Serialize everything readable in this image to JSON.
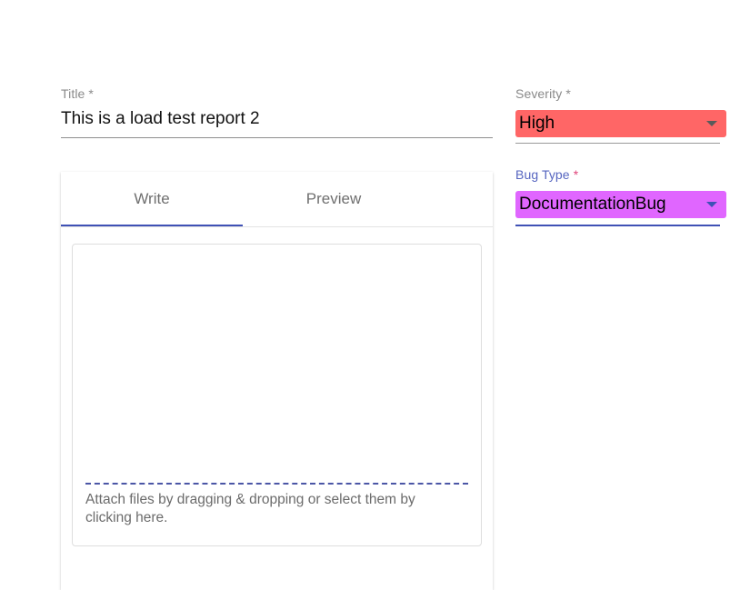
{
  "title_field": {
    "label": "Title *",
    "value": "This is a load test report 2"
  },
  "editor": {
    "tabs": [
      {
        "label": "Write",
        "active": true
      },
      {
        "label": "Preview",
        "active": false
      }
    ],
    "attach_text": "Attach files by dragging & dropping or select them by clicking here."
  },
  "severity": {
    "label": "Severity *",
    "value": "High",
    "color": "#ff6666"
  },
  "bug_type": {
    "label": "Bug Type",
    "required_mark": "*",
    "value": "DocumentationBug",
    "color": "#e066ff",
    "accent": "#3f51b5"
  }
}
